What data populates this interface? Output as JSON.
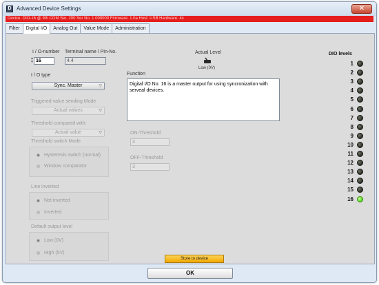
{
  "window": {
    "title": "Advanced Device Settings",
    "close_glyph": "✕",
    "app_icon": "D"
  },
  "status_bar": {
    "text": "Device: DIO-16 @ 9th COM  Ser. 200  Ser No. 1 000000  Firmware: 1.0a  Host: USB  Hardware: 4c"
  },
  "tabs": [
    "Filter",
    "Digital I/O",
    "Analog Out",
    "Value Mode",
    "Administration"
  ],
  "active_tab": "Digital I/O",
  "form": {
    "io_number_label": "I / O-number",
    "io_number_value": "16",
    "terminal_label": "Terminal name / Pin-No.",
    "terminal_value": "4.4",
    "io_type_label": "I / O type",
    "io_type_value": "Sync. Master",
    "triggered_label": "Triggered value sending Mode",
    "triggered_value": "Actual values",
    "threshold_compared_label": "Threshold compared with:",
    "threshold_compared_value": "Actual value",
    "threshold_switch_label": "Threshold switch Mode",
    "threshold_switch_options": [
      "Hysteresis switch (normal)",
      "Window comparator"
    ],
    "line_inverted_label": "Line inverted",
    "line_inverted_options": [
      "Not inverted",
      "Inverted"
    ],
    "default_output_label": "Default output level",
    "default_output_options": [
      "Low (0V)",
      "High (5V)"
    ]
  },
  "actual_level": {
    "label": "Actual Level",
    "value": "Low (0V)"
  },
  "function": {
    "label": "Function",
    "text": "Digital I/O No. 16 is a  master output for using syncronization with serveal devices."
  },
  "thresholds": {
    "on_label": "ON-Threshold",
    "on_value": "3",
    "off_label": "OFF-Threshold",
    "off_value": "3"
  },
  "dio_levels": {
    "title": "DIO levels",
    "items": [
      {
        "n": "1",
        "on": false
      },
      {
        "n": "2",
        "on": false
      },
      {
        "n": "3",
        "on": false
      },
      {
        "n": "4",
        "on": false
      },
      {
        "n": "5",
        "on": false
      },
      {
        "n": "6",
        "on": false
      },
      {
        "n": "7",
        "on": false
      },
      {
        "n": "8",
        "on": false
      },
      {
        "n": "9",
        "on": false
      },
      {
        "n": "10",
        "on": false
      },
      {
        "n": "11",
        "on": false
      },
      {
        "n": "12",
        "on": false
      },
      {
        "n": "13",
        "on": false
      },
      {
        "n": "14",
        "on": false
      },
      {
        "n": "15",
        "on": false
      },
      {
        "n": "16",
        "on": true
      }
    ]
  },
  "buttons": {
    "store": "Store to device",
    "ok": "OK"
  },
  "colors": {
    "status_bar": "#e51e1e",
    "store_button": "#f5b800",
    "led_on": "#52d61e",
    "led_off": "#3a3e37"
  }
}
